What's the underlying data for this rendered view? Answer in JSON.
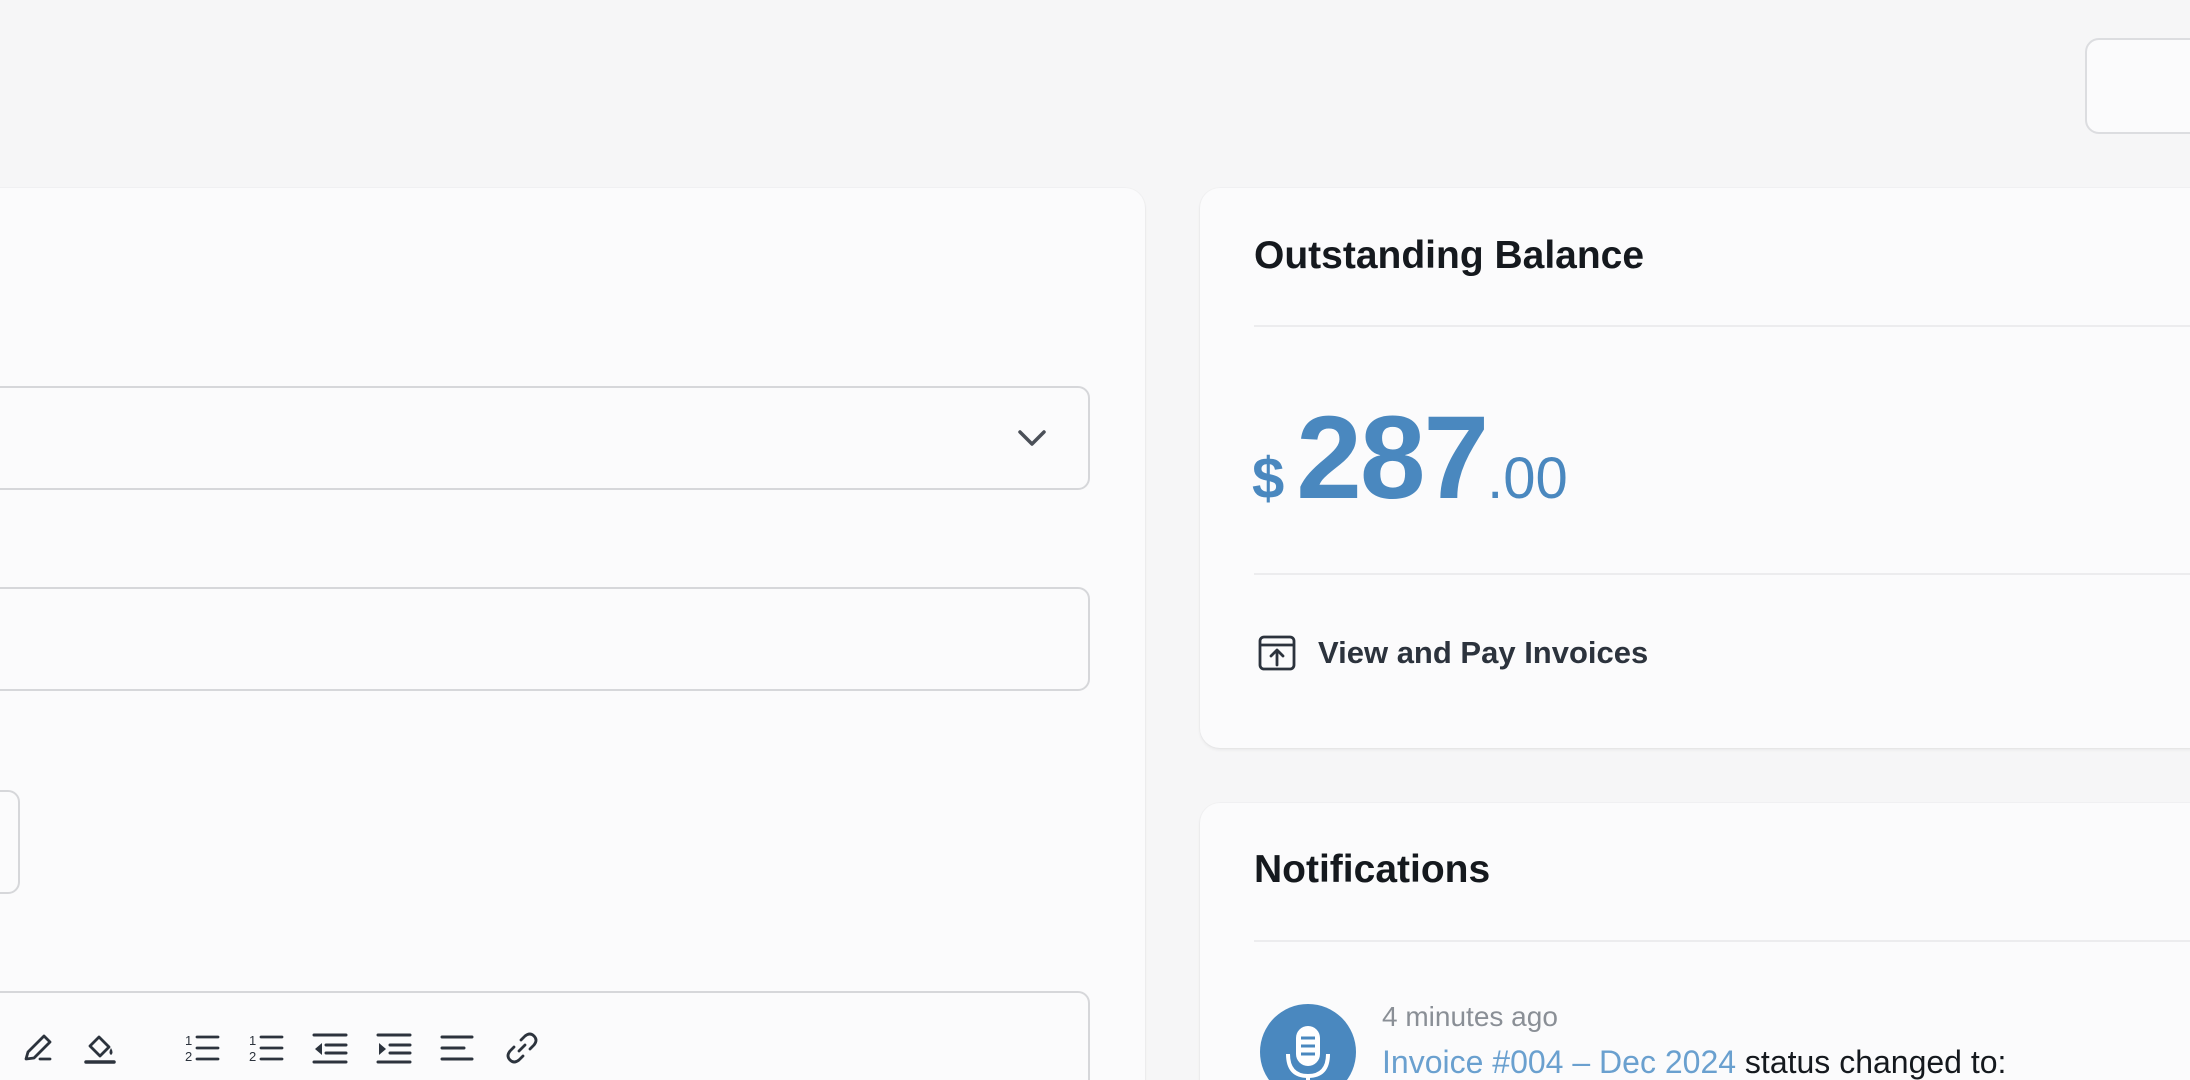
{
  "balance_card": {
    "title": "Outstanding Balance",
    "currency_symbol": "$",
    "amount_whole": "287",
    "amount_cents": ".00",
    "pay_link_label": "View and Pay Invoices"
  },
  "notifications_card": {
    "title": "Notifications",
    "items": [
      {
        "time": "4 minutes ago",
        "link_text": "Invoice #004 – Dec 2024",
        "message": " status changed to:"
      }
    ]
  },
  "colors": {
    "accent": "#4a88bf",
    "link": "#6aa0cf",
    "background": "#f6f6f7",
    "card": "#fbfbfc"
  },
  "icons": {
    "select_chevron": "chevron-down-icon",
    "pay_link": "external-upload-icon",
    "notification": "microphone-icon",
    "toolbar": [
      "pen-icon",
      "fill-icon",
      "ordered-list-icon",
      "ordered-list-alt-icon",
      "outdent-icon",
      "indent-icon",
      "align-left-icon",
      "link-icon"
    ]
  }
}
